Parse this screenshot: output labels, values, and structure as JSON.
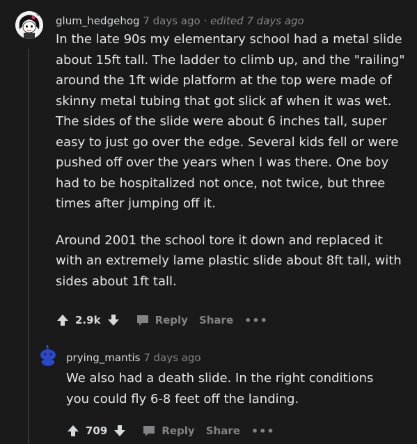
{
  "comments": [
    {
      "username": "glum_hedgehog",
      "time": "7 days ago",
      "separator": "·",
      "edited": "edited 7 days ago",
      "paragraphs": [
        "In the late 90s my elementary school had a metal slide about 15ft tall. The ladder to climb up, and the \"railing\" around the 1ft wide platform at the top were made of skinny metal tubing that got slick af when it was wet. The sides of the slide were about 6 inches tall, super easy to just go over the edge. Several kids fell or were pushed off over the years when I was there. One boy had to be hospitalized not once, not twice, but three times after jumping off it.",
        "Around 2001 the school tore it down and replaced it with an extremely lame plastic slide about 8ft tall, with sides about 1ft tall."
      ],
      "score": "2.9k",
      "reply_label": "Reply",
      "share_label": "Share",
      "more_label": "•••"
    },
    {
      "username": "prying_mantis",
      "time": "7 days ago",
      "paragraphs": [
        "We also had a death slide. In the right conditions you could fly 6-8 feet off the landing."
      ],
      "score": "709",
      "reply_label": "Reply",
      "share_label": "Share",
      "more_label": "•••"
    }
  ],
  "colors": {
    "background": "#1a1a1b",
    "text": "#d7dadc",
    "muted": "#818384",
    "thread_line": "#343536"
  },
  "icons": {
    "upvote": "arrow-up-icon",
    "downvote": "arrow-down-icon",
    "reply": "speech-bubble-icon",
    "avatar_1": "snoo-avatar-girl",
    "avatar_2": "snoo-avatar-blue"
  }
}
